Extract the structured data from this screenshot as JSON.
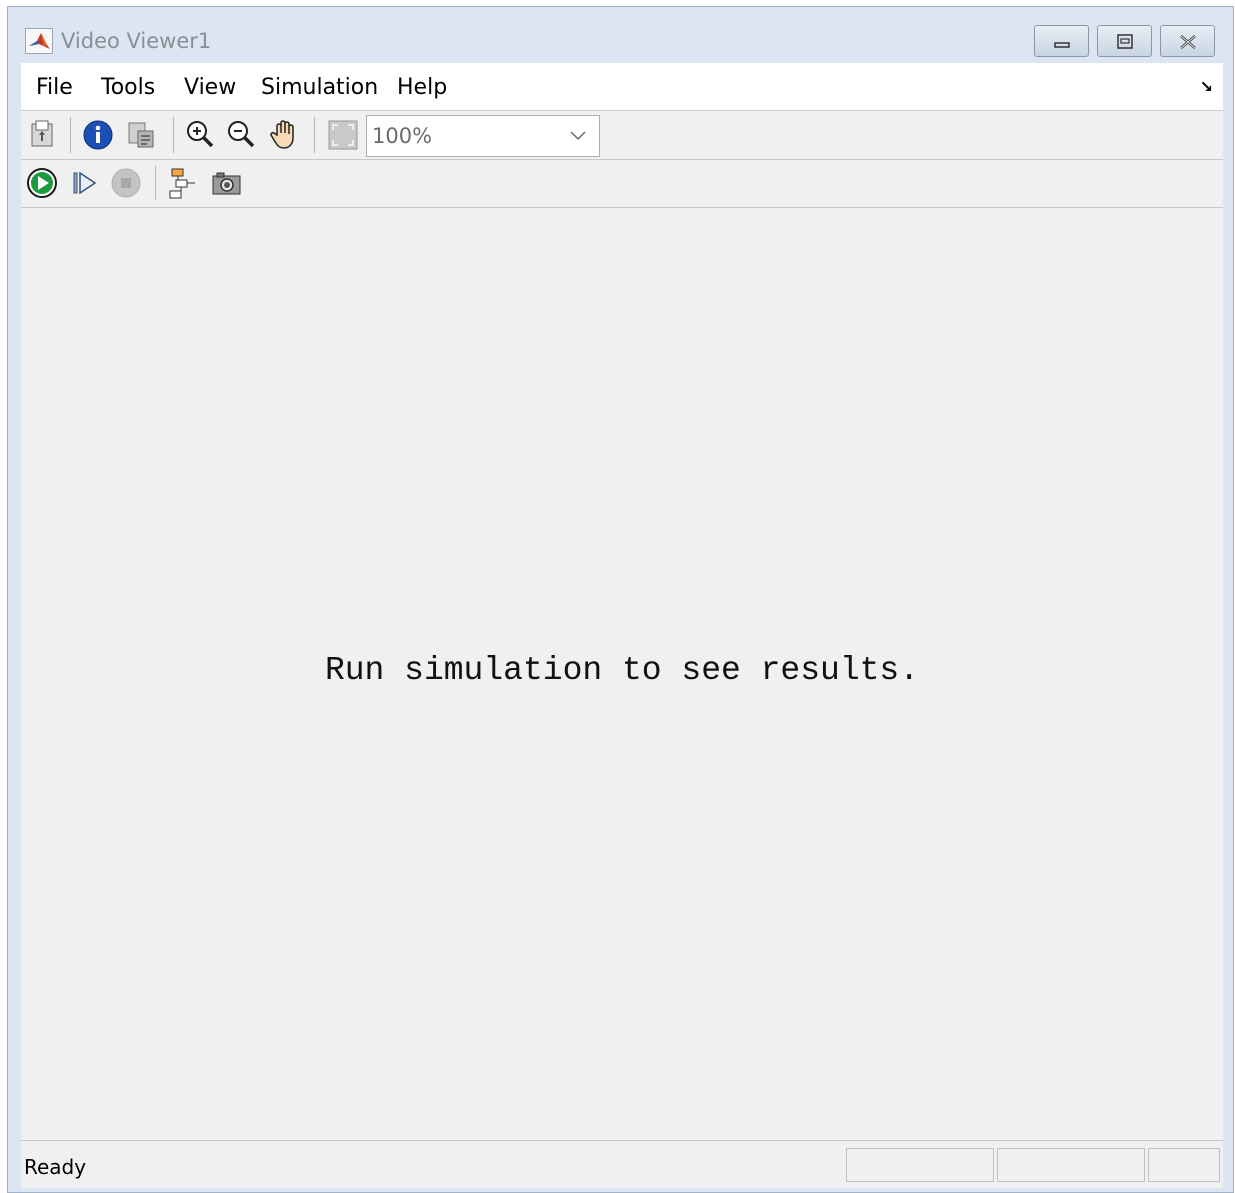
{
  "window": {
    "title": "Video Viewer1",
    "controls": [
      "minimize-icon",
      "restore-icon",
      "close-icon"
    ]
  },
  "menubar": {
    "items": [
      {
        "label": "File"
      },
      {
        "label": "Tools"
      },
      {
        "label": "View"
      },
      {
        "label": "Simulation"
      },
      {
        "label": "Help"
      }
    ],
    "dock_icon": "undock-arrow-icon"
  },
  "toolbar1": {
    "icons": [
      "print-icon",
      "info-icon",
      "properties-icon",
      "zoom-in-icon",
      "zoom-out-icon",
      "pan-hand-icon",
      "fit-to-view-icon"
    ],
    "zoom": {
      "value": "100%"
    }
  },
  "toolbar2": {
    "icons": [
      "run-icon",
      "step-forward-icon",
      "stop-icon",
      "highlight-block-icon",
      "snapshot-camera-icon"
    ]
  },
  "canvas": {
    "message": "Run simulation to see results."
  },
  "statusbar": {
    "text": "Ready"
  },
  "colors": {
    "run_green": "#1a9c3e",
    "info_blue": "#1c4fb5",
    "title_gray": "#8a8f96",
    "frame": "#dbe6f2"
  }
}
